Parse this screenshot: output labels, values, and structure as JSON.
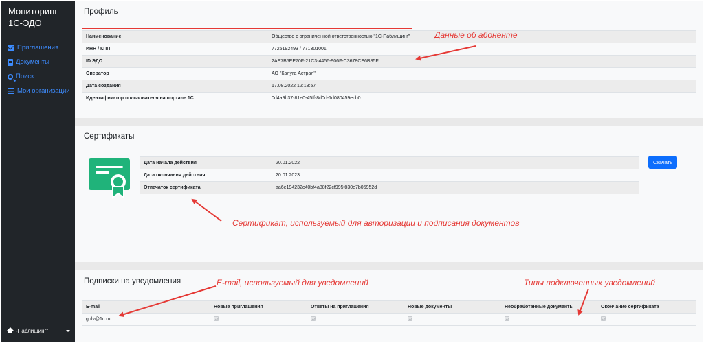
{
  "sidebar": {
    "brand_line1": "Мониторинг",
    "brand_line2": "1С-ЭДО",
    "items": [
      {
        "label": "Приглашения",
        "icon": "envelope-icon"
      },
      {
        "label": "Документы",
        "icon": "document-icon"
      },
      {
        "label": "Поиск",
        "icon": "search-icon"
      },
      {
        "label": "Мои организации",
        "icon": "list-icon"
      }
    ],
    "user_label": "-Паблишинг\""
  },
  "profile": {
    "title": "Профиль",
    "rows": [
      {
        "key": "Наименование",
        "value": "Общество с ограниченной ответственностью \"1С-Паблишинг\""
      },
      {
        "key": "ИНН / КПП",
        "value": "7725192493 / 771301001"
      },
      {
        "key": "ID ЭДО",
        "value": "2AE7B5EE70F-21C3-4456-906F-C3678CE6B85F"
      },
      {
        "key": "Оператор",
        "value": "АО \"Калуга Астрал\""
      },
      {
        "key": "Дата создания",
        "value": "17.08.2022 12:18:57"
      },
      {
        "key": "Идентификатор пользователя на портале 1С",
        "value": "0d4a9b37-81e0-45ff-8d0d-1d080459ecb0"
      }
    ]
  },
  "certificates": {
    "title": "Сертификаты",
    "rows": [
      {
        "key": "Дата начала действия",
        "value": "20.01.2022"
      },
      {
        "key": "Дата окончания действия",
        "value": "20.01.2023"
      },
      {
        "key": "Отпечаток сертификата",
        "value": "aa6e194232c40bf4a88f22cf995f830e7b05952d"
      }
    ],
    "download_label": "Скачать",
    "icon_color": "#20b37a"
  },
  "subscriptions": {
    "title": "Подписки на уведомления",
    "columns": [
      "E-mail",
      "Новые приглашения",
      "Ответы на приглашения",
      "Новые документы",
      "Необработанные документы",
      "Окончание сертификата"
    ],
    "row": {
      "email": "gulv@1c.ru"
    }
  },
  "annotations": {
    "subscriber": "Данные об абоненте",
    "certificate": "Сертификат, используемый для авторизации и подписания документов",
    "email": "E-mail, используемый для уведомлений",
    "types": "Типы подключенных уведомлений"
  },
  "colors": {
    "accent": "#0d6efd",
    "sidebar": "#212529",
    "annotation": "#e53935"
  }
}
